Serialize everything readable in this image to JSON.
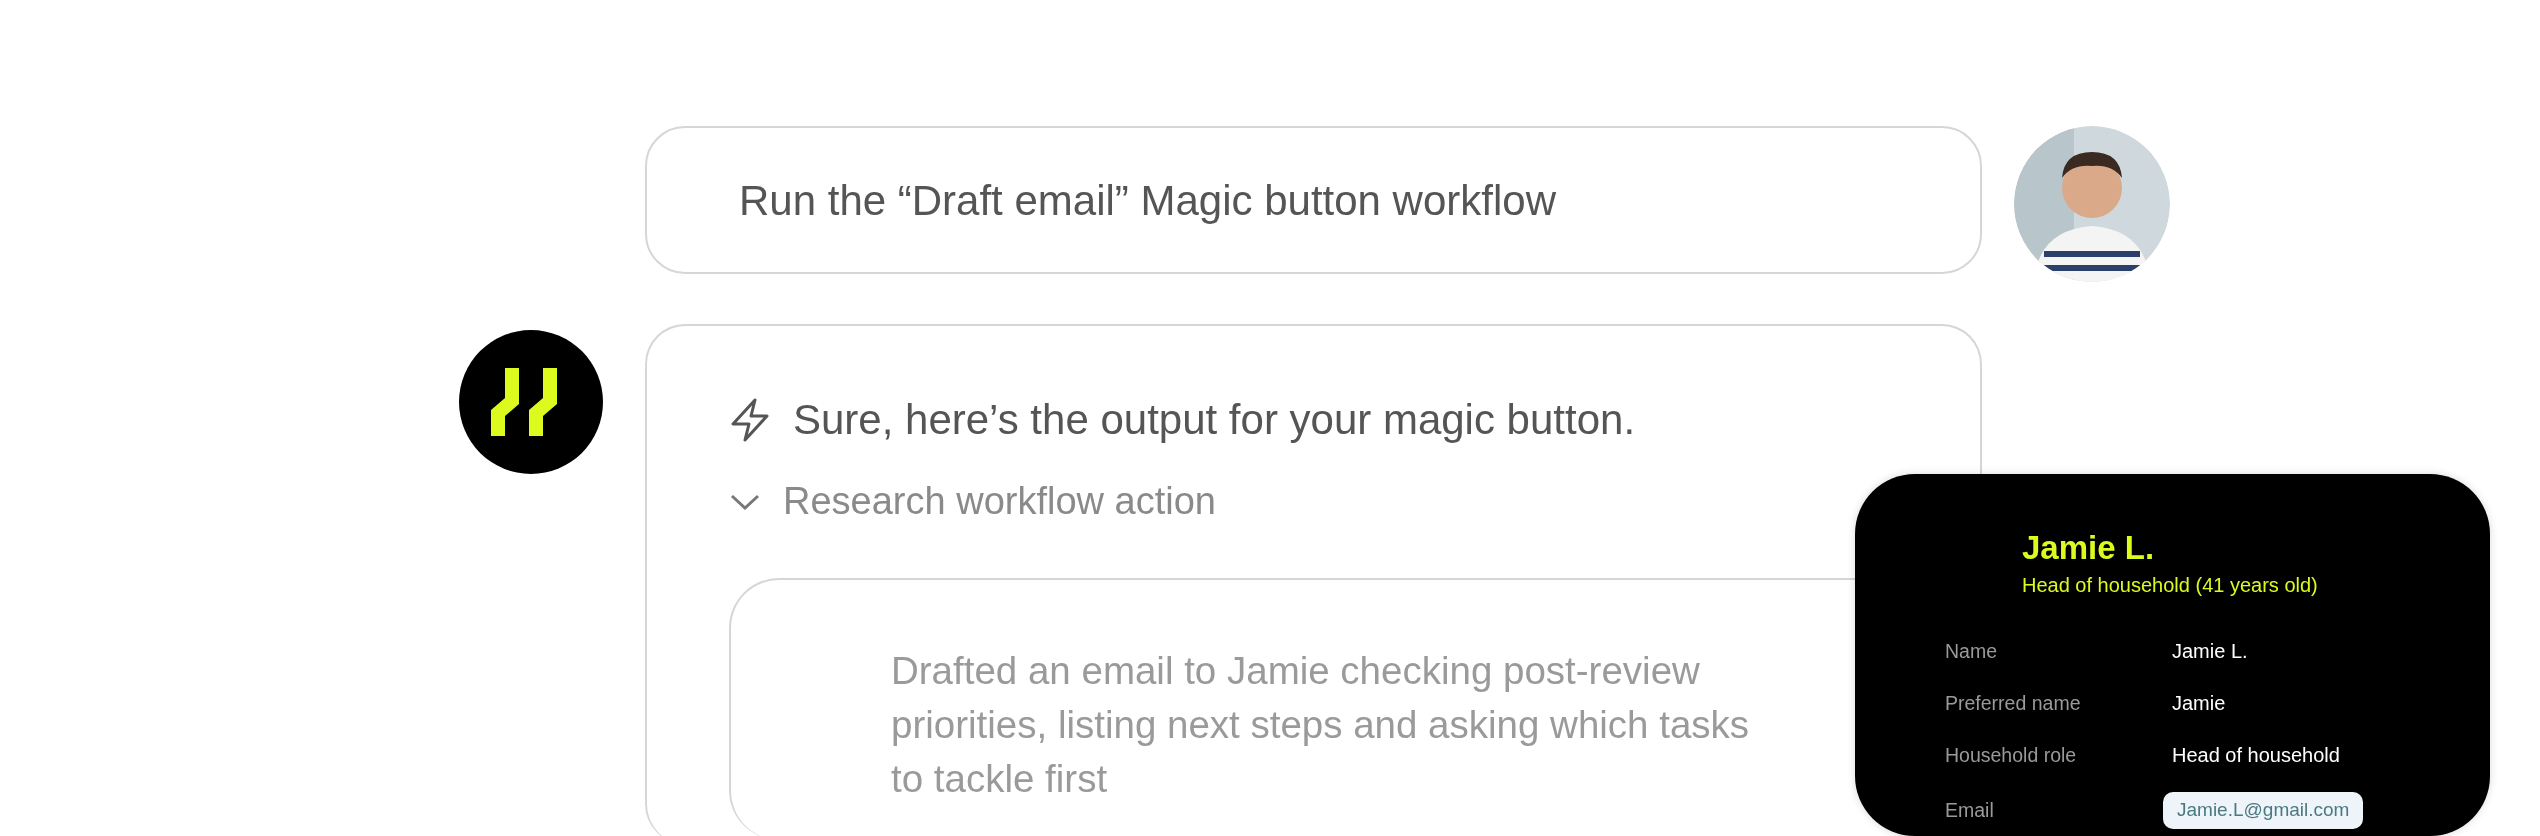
{
  "user_message": {
    "text": "Run the “Draft email” Magic button workflow"
  },
  "assistant": {
    "message": "Sure, here’s the output for your magic button.",
    "action": {
      "label": "Research workflow action",
      "expanded": true
    },
    "result": "Drafted an email to Jamie checking post-review priorities, listing next steps and asking which tasks to tackle first"
  },
  "profile_card": {
    "name": "Jamie L.",
    "subtitle": "Head of household (41 years old)",
    "fields": [
      {
        "label": "Name",
        "value": "Jamie L.",
        "kind": "text"
      },
      {
        "label": "Preferred name",
        "value": "Jamie",
        "kind": "text"
      },
      {
        "label": "Household role",
        "value": "Head of household",
        "kind": "text"
      },
      {
        "label": "Email",
        "value": "Jamie.L@gmail.com",
        "kind": "email"
      }
    ]
  }
}
